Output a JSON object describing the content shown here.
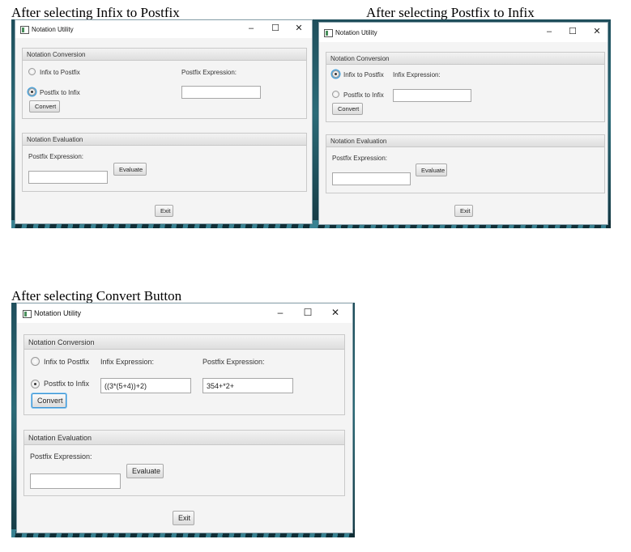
{
  "captions": {
    "first": "After selecting Infix to Postfix",
    "second": "After selecting Postfix to Infix",
    "third": "After selecting Convert Button"
  },
  "window": {
    "title": "Notation Utility",
    "minimize": "–",
    "maximize": "☐",
    "close": "✕"
  },
  "conversion": {
    "header": "Notation Conversion",
    "radio_infix": "Infix to Postfix",
    "radio_postfix": "Postfix to Infix",
    "convert": "Convert",
    "infix_label": "Infix Expression:",
    "postfix_label": "Postfix Expression:"
  },
  "evaluation": {
    "header": "Notation Evaluation",
    "postfix_label": "Postfix Expression:",
    "evaluate": "Evaluate"
  },
  "exit": "Exit",
  "converted": {
    "infix_value": "((3*(5+4))+2)",
    "postfix_value": "354+*2+"
  },
  "colors": {
    "focus": "#4fa3d8",
    "desktop": "#2b6b78"
  }
}
